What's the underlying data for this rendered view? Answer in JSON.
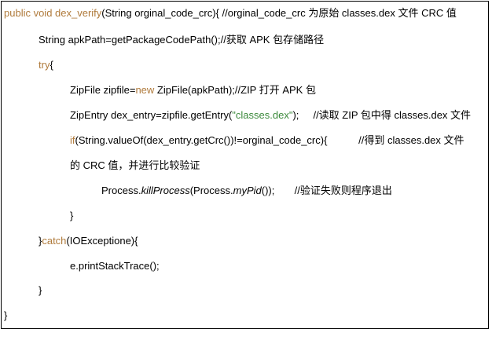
{
  "code": {
    "l1": {
      "kw": "public void dex_verify",
      "text": "(String orginal_code_crc){ //orginal_code_crc 为原始 classes.dex 文件 CRC 值"
    },
    "l2": {
      "text": "String apkPath=getPackageCodePath();//获取 APK 包存储路径"
    },
    "l3": {
      "kw": "try",
      "text": "{"
    },
    "l4": {
      "pre": "ZipFile zipfile=",
      "kw": "new",
      "post": " ZipFile(apkPath);//ZIP 打开 APK 包"
    },
    "l5": {
      "pre": "ZipEntry dex_entry=zipfile.getEntry(",
      "str": "\"classes.dex\"",
      "post": ");     //读取 ZIP 包中得 classes.dex 文件"
    },
    "l6": {
      "kw": "if",
      "text": "(String.valueOf(dex_entry.getCrc())!=orginal_code_crc){           //得到 classes.dex 文件"
    },
    "l7": {
      "text": "的 CRC 值，并进行比较验证"
    },
    "l8": {
      "pre": "Process.",
      "it1": "killProcess",
      "mid": "(Process.",
      "it2": "myPid",
      "post": "());       //验证失败则程序退出"
    },
    "l9": {
      "text": "}"
    },
    "l10": {
      "pre": "}",
      "kw": "catch",
      "post": "(IOExceptione){"
    },
    "l11": {
      "text": "e.printStackTrace();"
    },
    "l12": {
      "text": "}"
    },
    "l13": {
      "text": "}"
    }
  }
}
